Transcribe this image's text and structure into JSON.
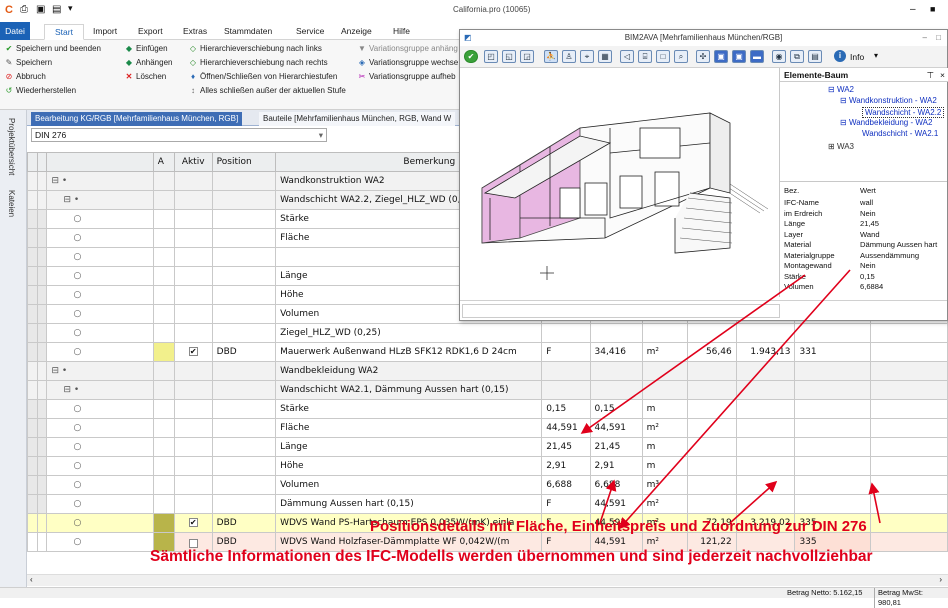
{
  "window": {
    "title": "California.pro (10065)",
    "min_label": "–",
    "max_label": "■"
  },
  "menu_tabs": [
    "Datei",
    "Start",
    "Import",
    "Export",
    "Extras",
    "Stammdaten",
    "Service",
    "Anzeige",
    "Hilfe"
  ],
  "ribbon": {
    "col1": [
      "Speichern und beenden",
      "Speichern",
      "Abbruch",
      "Wiederherstellen"
    ],
    "col2": [
      "Einfügen",
      "Anhängen",
      "Löschen"
    ],
    "col3": [
      "Hierarchieverschiebung nach links",
      "Hierarchieverschiebung nach rechts",
      "Öffnen/Schließen von Hierarchiestufen",
      "Alles schließen außer der aktuellen Stufe"
    ],
    "col4": [
      "Variationsgruppe anhäng",
      "Variationsgruppe wechse",
      "Variationsgruppe aufheb"
    ]
  },
  "sidebar": {
    "tab1": "Projektübersicht",
    "tab2": "Kateien"
  },
  "doc_tabs": [
    "Bearbeitung KG/RGB [Mehrfamilienhaus München, RGB]",
    "Bauteile [Mehrfamilienhaus München, RGB, Wand W"
  ],
  "din_select": "DIN 276",
  "grid": {
    "headers": [
      "",
      "",
      "",
      "A",
      "Aktiv",
      "Position",
      "Bemerkung",
      "",
      "",
      "",
      "",
      "",
      ""
    ],
    "rows": [
      {
        "tree": "⊟ •",
        "a": "",
        "aktiv": "",
        "pos": "",
        "bem": "Wandkonstruktion WA2",
        "c1": "",
        "c2": "",
        "c3": "",
        "c4": "",
        "c5": "",
        "c6": "",
        "style": "grp"
      },
      {
        "tree": "⊟ •",
        "a": "",
        "aktiv": "",
        "pos": "",
        "bem": "Wandschicht WA2.2, Ziegel_HLZ_WD (0,25)",
        "c1": "",
        "c2": "",
        "c3": "",
        "c4": "",
        "c5": "",
        "c6": "",
        "style": "grp"
      },
      {
        "tree": "○",
        "a": "",
        "aktiv": "",
        "pos": "",
        "bem": "Stärke",
        "c1": "",
        "c2": "",
        "c3": "",
        "c4": "",
        "c5": "",
        "c6": "",
        "style": ""
      },
      {
        "tree": "○",
        "a": "",
        "aktiv": "",
        "pos": "",
        "bem": "Fläche",
        "c1": "",
        "c2": "",
        "c3": "",
        "c4": "",
        "c5": "",
        "c6": "",
        "style": ""
      },
      {
        "tree": "○",
        "a": "",
        "aktiv": "",
        "pos": "",
        "bem": "",
        "c1": "",
        "c2": "",
        "c3": "",
        "c4": "",
        "c5": "",
        "c6": "",
        "style": ""
      },
      {
        "tree": "○",
        "a": "",
        "aktiv": "",
        "pos": "",
        "bem": "Länge",
        "c1": "",
        "c2": "",
        "c3": "",
        "c4": "",
        "c5": "",
        "c6": "",
        "style": ""
      },
      {
        "tree": "○",
        "a": "",
        "aktiv": "",
        "pos": "",
        "bem": "Höhe",
        "c1": "",
        "c2": "",
        "c3": "",
        "c4": "",
        "c5": "",
        "c6": "",
        "style": ""
      },
      {
        "tree": "○",
        "a": "",
        "aktiv": "",
        "pos": "",
        "bem": "Volumen",
        "c1": "",
        "c2": "",
        "c3": "",
        "c4": "",
        "c5": "",
        "c6": "",
        "style": ""
      },
      {
        "tree": "○",
        "a": "",
        "aktiv": "",
        "pos": "",
        "bem": "Ziegel_HLZ_WD (0,25)",
        "c1": "",
        "c2": "",
        "c3": "",
        "c4": "",
        "c5": "",
        "c6": "",
        "style": ""
      },
      {
        "tree": "○",
        "a": "",
        "aktiv": "✔",
        "pos": "DBD",
        "bem": "Mauerwerk Außenwand HLzB SFK12 RDK1,6 D 24cm",
        "c1": "F",
        "c2": "34,416",
        "c3": "m²",
        "c4": "56,46",
        "c5": "1.943,13",
        "c6": "331",
        "style": "mw"
      },
      {
        "tree": "⊟ •",
        "a": "",
        "aktiv": "",
        "pos": "",
        "bem": "Wandbekleidung WA2",
        "c1": "",
        "c2": "",
        "c3": "",
        "c4": "",
        "c5": "",
        "c6": "",
        "style": "grp"
      },
      {
        "tree": "⊟ •",
        "a": "",
        "aktiv": "",
        "pos": "",
        "bem": "Wandschicht WA2.1, Dämmung Aussen hart (0,15)",
        "c1": "",
        "c2": "",
        "c3": "",
        "c4": "",
        "c5": "",
        "c6": "",
        "style": "grp"
      },
      {
        "tree": "○",
        "a": "",
        "aktiv": "",
        "pos": "",
        "bem": "Stärke",
        "c1": "0,15",
        "c2": "0,15",
        "c3": "m",
        "c4": "",
        "c5": "",
        "c6": "",
        "style": ""
      },
      {
        "tree": "○",
        "a": "",
        "aktiv": "",
        "pos": "",
        "bem": "Fläche",
        "c1": "44,591",
        "c2": "44,591",
        "c3": "m²",
        "c4": "",
        "c5": "",
        "c6": "",
        "style": ""
      },
      {
        "tree": "○",
        "a": "",
        "aktiv": "",
        "pos": "",
        "bem": "Länge",
        "c1": "21,45",
        "c2": "21,45",
        "c3": "m",
        "c4": "",
        "c5": "",
        "c6": "",
        "style": ""
      },
      {
        "tree": "○",
        "a": "",
        "aktiv": "",
        "pos": "",
        "bem": "Höhe",
        "c1": "2,91",
        "c2": "2,91",
        "c3": "m",
        "c4": "",
        "c5": "",
        "c6": "",
        "style": ""
      },
      {
        "tree": "○",
        "a": "",
        "aktiv": "",
        "pos": "",
        "bem": "Volumen",
        "c1": "6,688",
        "c2": "6,688",
        "c3": "m³",
        "c4": "",
        "c5": "",
        "c6": "",
        "style": ""
      },
      {
        "tree": "○",
        "a": "",
        "aktiv": "",
        "pos": "",
        "bem": "Dämmung Aussen hart (0,15)",
        "c1": "F",
        "c2": "44,591",
        "c3": "m²",
        "c4": "",
        "c5": "",
        "c6": "",
        "style": ""
      },
      {
        "tree": "○",
        "a": "",
        "aktiv": "✔",
        "pos": "DBD",
        "bem": "WDVS Wand PS-Hartschaum EPS 0,035W/(mK) einla",
        "c1": "F",
        "c2": "44,591",
        "c3": "m²",
        "c4": "72,19",
        "c5": "3.219,02",
        "c6": "335",
        "style": "hl"
      },
      {
        "tree": "○",
        "a": "",
        "aktiv": "☐",
        "pos": "DBD",
        "bem": "WDVS Wand Holzfaser-Dämmplatte WF 0,042W/(m",
        "c1": "F",
        "c2": "44,591",
        "c3": "m²",
        "c4": "121,22",
        "c5": "",
        "c6": "335",
        "style": "pk"
      }
    ]
  },
  "bim_window": {
    "title": "BIM2AVA [Mehrfamilienhaus München/RGB]",
    "info_label": "Info",
    "tree_title": "Elemente-Baum",
    "tree_nodes": [
      "WA2",
      "Wandkonstruktion - WA2",
      "Wandschicht - WA2.2",
      "Wandbekleidung - WA2",
      "Wandschicht - WA2.1",
      "WA3"
    ],
    "props_header": [
      "Bez.",
      "Wert"
    ],
    "props": [
      [
        "IFC-Name",
        "wall"
      ],
      [
        "im Erdreich",
        "Nein"
      ],
      [
        "Länge",
        "21,45"
      ],
      [
        "Layer",
        "Wand"
      ],
      [
        "Material",
        "Dämmung Aussen hart"
      ],
      [
        "Materialgruppe",
        "Aussendämmung"
      ],
      [
        "Montagewand",
        "Nein"
      ],
      [
        "Stärke",
        "0,15"
      ],
      [
        "Volumen",
        "6,6884"
      ]
    ]
  },
  "annotations": {
    "a1": "Positionsdetails mit Fläche, Einheitspreis und Zuordnung zur DIN 276",
    "a2": "Sämtliche Informationen des IFC-Modells werden übernommen und sind jederzeit nachvollziehbar",
    "color": "#e0001b"
  },
  "status": {
    "netto": "Betrag Netto: 5.162,15",
    "mwst": "Betrag MwSt: 980,81"
  }
}
